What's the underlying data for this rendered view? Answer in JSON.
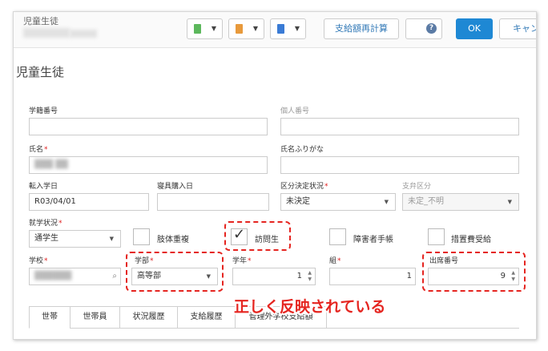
{
  "window": {
    "title": "児童生徒"
  },
  "toolbar": {
    "icon_buttons": [
      {
        "icon": "green-clipboard-icon",
        "color": "#5cb85c"
      },
      {
        "icon": "orange-clipboard-icon",
        "color": "#e89a3c"
      },
      {
        "icon": "blue-clipboard-icon",
        "color": "#3a7bd5"
      }
    ],
    "recalc_label": "支給額再計算",
    "help_label": "?",
    "ok_label": "OK",
    "cancel_label": "キャンセル"
  },
  "page": {
    "title": "児童生徒"
  },
  "fields": {
    "student_no": {
      "label": "学籍番号",
      "value": ""
    },
    "personal_no": {
      "label": "個人番号",
      "value": ""
    },
    "name": {
      "label": "氏名",
      "value": "",
      "required": true
    },
    "name_kana": {
      "label": "氏名ふりがな",
      "value": ""
    },
    "transfer_date": {
      "label": "転入学日",
      "value": "R03/04/01"
    },
    "purchase_date": {
      "label": "寝具購入日",
      "value": ""
    },
    "category_status": {
      "label": "区分決定状況",
      "value": "未決定",
      "required": true
    },
    "payment_category": {
      "label": "支弁区分",
      "value": "未定_不明"
    },
    "enroll_status": {
      "label": "就学状況",
      "value": "通学生",
      "required": true
    },
    "school": {
      "label": "学校",
      "value": "",
      "required": true
    },
    "department": {
      "label": "学部",
      "value": "高等部",
      "required": true
    },
    "grade": {
      "label": "学年",
      "value": "1",
      "required": true
    },
    "class": {
      "label": "組",
      "value": "1",
      "required": true
    },
    "attendance_no": {
      "label": "出席番号",
      "value": "9"
    }
  },
  "checkboxes": [
    {
      "label": "肢体重複",
      "checked": false
    },
    {
      "label": "訪問生",
      "checked": true
    },
    {
      "label": "障害者手帳",
      "checked": false
    },
    {
      "label": "措置費受給",
      "checked": false
    }
  ],
  "required_mark": "*",
  "annotation": "正しく反映されている",
  "tabs": [
    "世帯",
    "世帯員",
    "状況履歴",
    "支給履歴",
    "管理外学校支給額"
  ],
  "colors": {
    "accent": "#1e88d4",
    "highlight": "#e52520",
    "required": "#e02020"
  }
}
